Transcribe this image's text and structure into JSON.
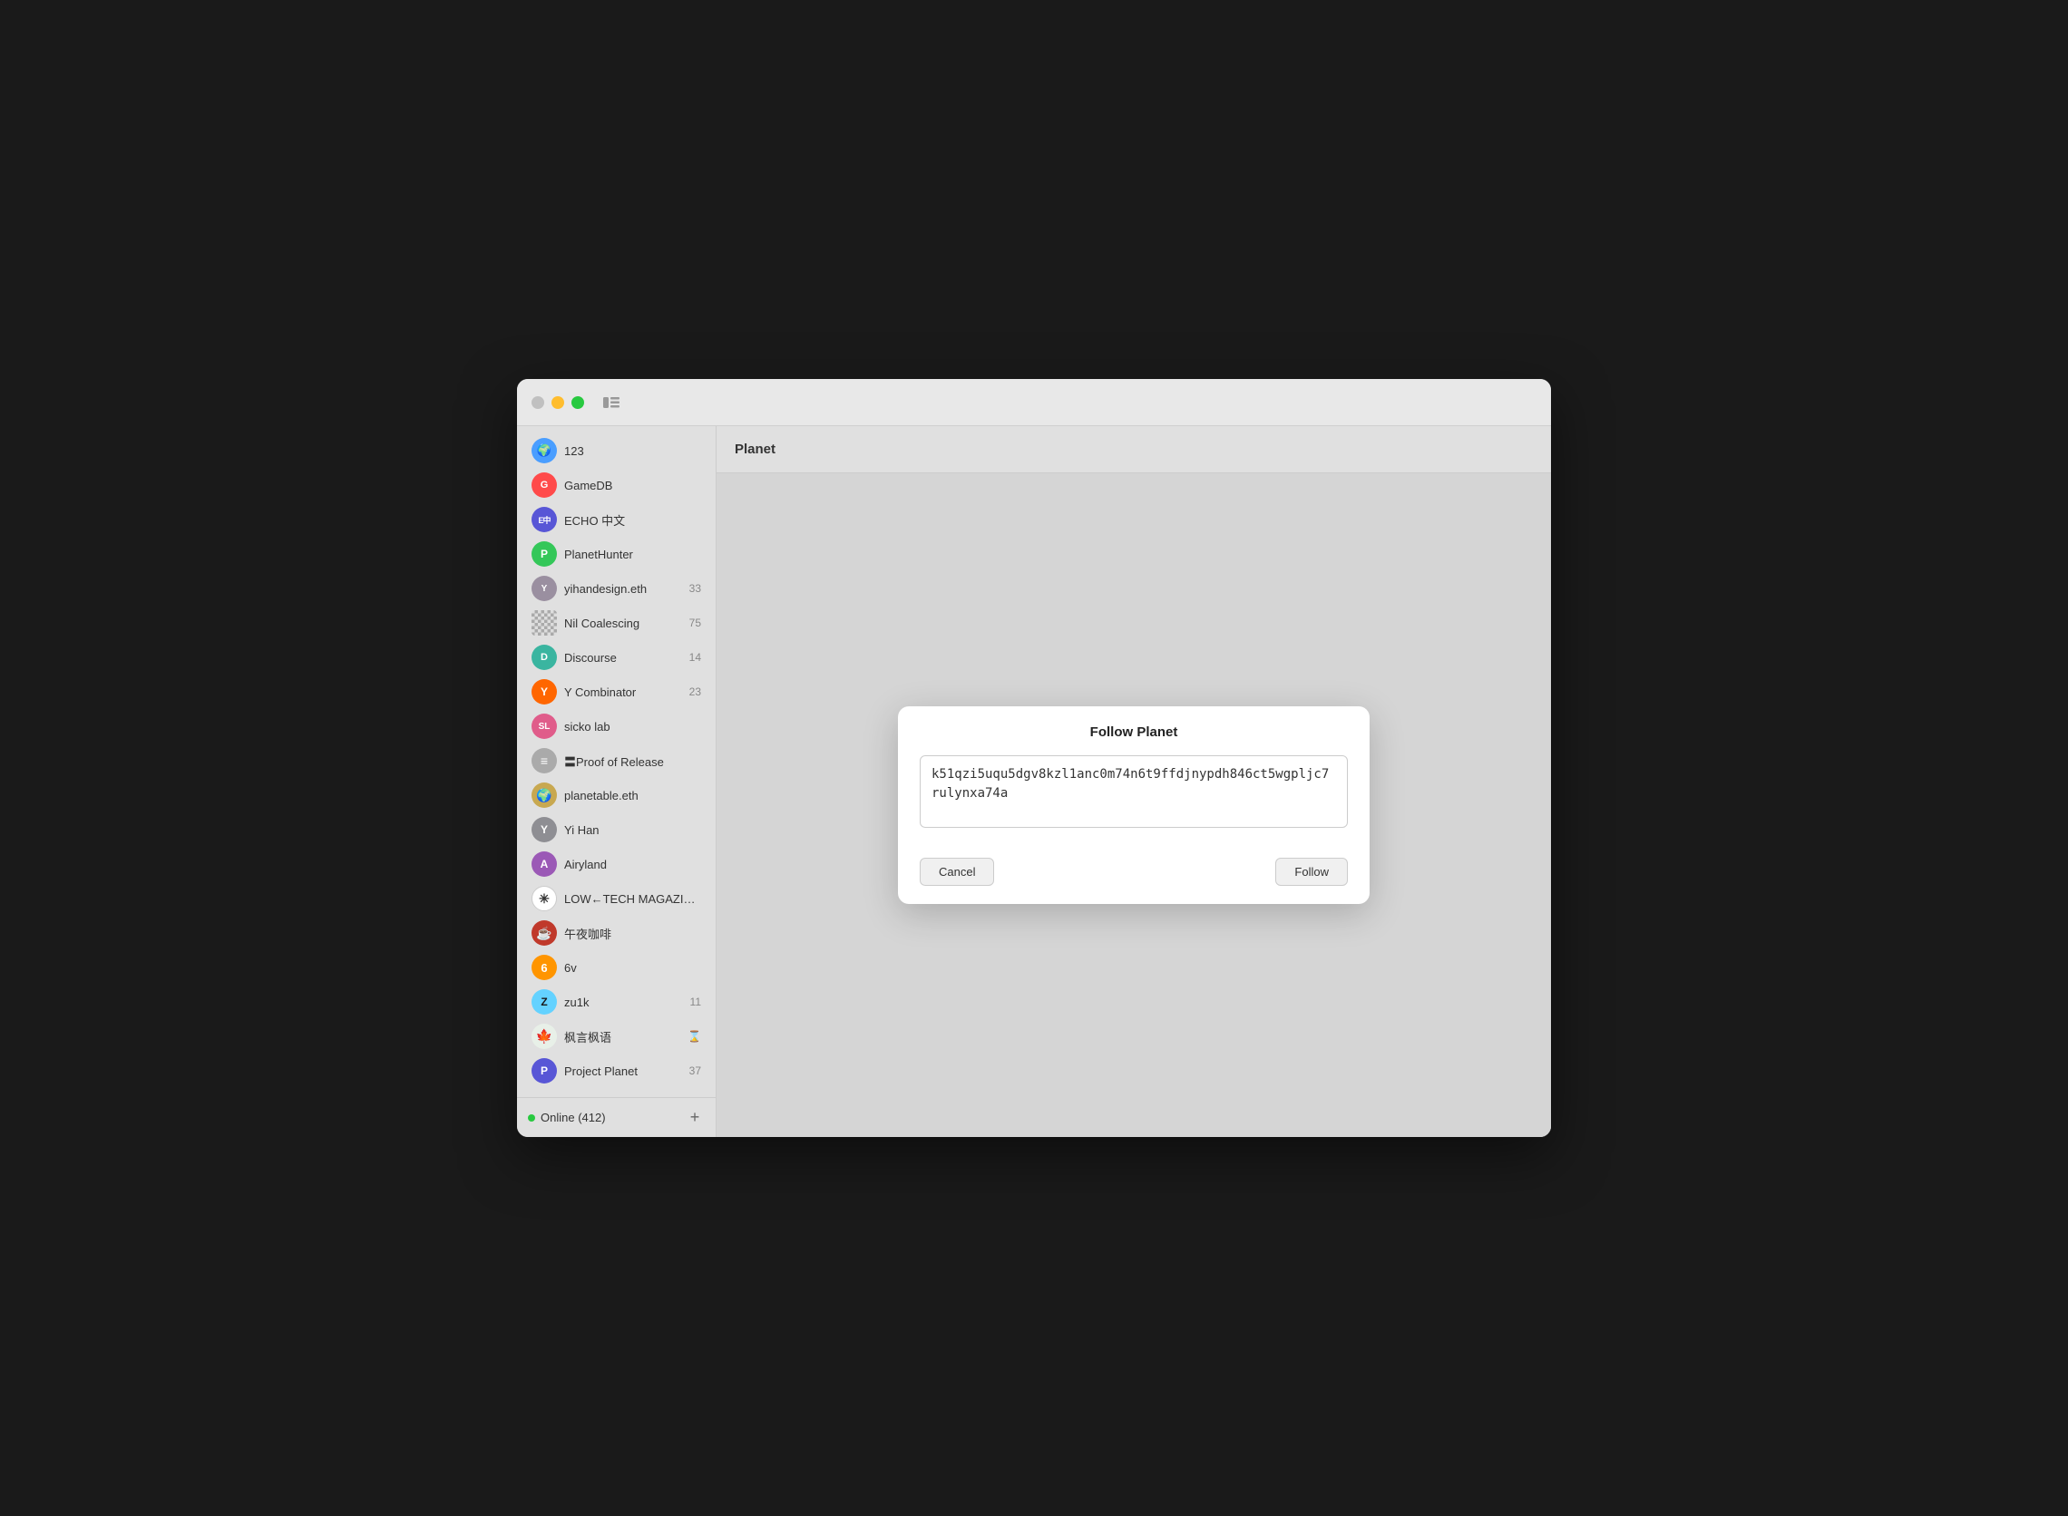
{
  "window": {
    "title": "Planet"
  },
  "sidebar": {
    "items": [
      {
        "id": "123",
        "label": "123",
        "avatarType": "image",
        "avatarColor": "avatar-blue",
        "avatarText": "🌍",
        "badge": ""
      },
      {
        "id": "gamedb",
        "label": "GameDB",
        "avatarType": "color",
        "avatarColor": "avatar-red",
        "avatarText": "G",
        "badge": ""
      },
      {
        "id": "echo",
        "label": "ECHO 中文",
        "avatarType": "color",
        "avatarColor": "avatar-indigo",
        "avatarText": "E中",
        "badge": ""
      },
      {
        "id": "planethunter",
        "label": "PlanetHunter",
        "avatarType": "color",
        "avatarColor": "avatar-green",
        "avatarText": "P",
        "badge": ""
      },
      {
        "id": "yihandesign",
        "label": "yihandesign.eth",
        "avatarType": "color",
        "avatarColor": "avatar-gray",
        "avatarText": "Y",
        "badge": "33"
      },
      {
        "id": "nil-coalescing",
        "label": "Nil Coalescing",
        "avatarType": "grid",
        "avatarColor": "avatar-grid",
        "avatarText": "",
        "badge": "75"
      },
      {
        "id": "discourse",
        "label": "Discourse",
        "avatarType": "color",
        "avatarColor": "avatar-teal",
        "avatarText": "D",
        "badge": "14"
      },
      {
        "id": "ycombinator",
        "label": "Y Combinator",
        "avatarType": "color",
        "avatarColor": "avatar-orange",
        "avatarText": "Y",
        "badge": "23"
      },
      {
        "id": "sickolab",
        "label": "sicko lab",
        "avatarType": "initials",
        "avatarColor": "avatar-purple",
        "avatarText": "SL",
        "badge": ""
      },
      {
        "id": "proof",
        "label": "〓Proof of Release",
        "avatarType": "color",
        "avatarColor": "avatar-darkgray",
        "avatarText": "≡",
        "badge": ""
      },
      {
        "id": "planetable",
        "label": "planetable.eth",
        "avatarType": "color",
        "avatarColor": "avatar-yellow",
        "avatarText": "🌍",
        "badge": ""
      },
      {
        "id": "yihan",
        "label": "Yi Han",
        "avatarType": "color",
        "avatarColor": "avatar-gray",
        "avatarText": "Y",
        "badge": ""
      },
      {
        "id": "airyland",
        "label": "Airyland",
        "avatarType": "color",
        "avatarColor": "avatar-purple",
        "avatarText": "A",
        "badge": ""
      },
      {
        "id": "lowtech",
        "label": "LOW←TECH MAGAZINE",
        "avatarType": "sun",
        "avatarColor": "avatar-sun",
        "avatarText": "✳",
        "badge": ""
      },
      {
        "id": "wuye",
        "label": "午夜咖啡",
        "avatarType": "color",
        "avatarColor": "avatar-red",
        "avatarText": "☕",
        "badge": ""
      },
      {
        "id": "6v",
        "label": "6v",
        "avatarType": "color",
        "avatarColor": "avatar-orange",
        "avatarText": "6",
        "badge": ""
      },
      {
        "id": "zu1k",
        "label": "zu1k",
        "avatarType": "color",
        "avatarColor": "avatar-lightblue",
        "avatarText": "Z",
        "badge": "11"
      },
      {
        "id": "fengyan",
        "label": "枫言枫语",
        "avatarType": "maple",
        "avatarColor": "avatar-maple",
        "avatarText": "🍁",
        "badge": "⌛"
      },
      {
        "id": "projectplanet",
        "label": "Project Planet",
        "avatarType": "color",
        "avatarColor": "avatar-indigo",
        "avatarText": "P",
        "badge": "37"
      }
    ],
    "footer": {
      "online_label": "Online (412)",
      "add_button_label": "+"
    }
  },
  "modal": {
    "title": "Follow Planet",
    "textarea_value": "k51qzi5uqu5dgv8kzl1anc0m74n6t9ffdjnypdh846ct5wgpljc7rulynxa74a",
    "cancel_label": "Cancel",
    "follow_label": "Follow"
  }
}
